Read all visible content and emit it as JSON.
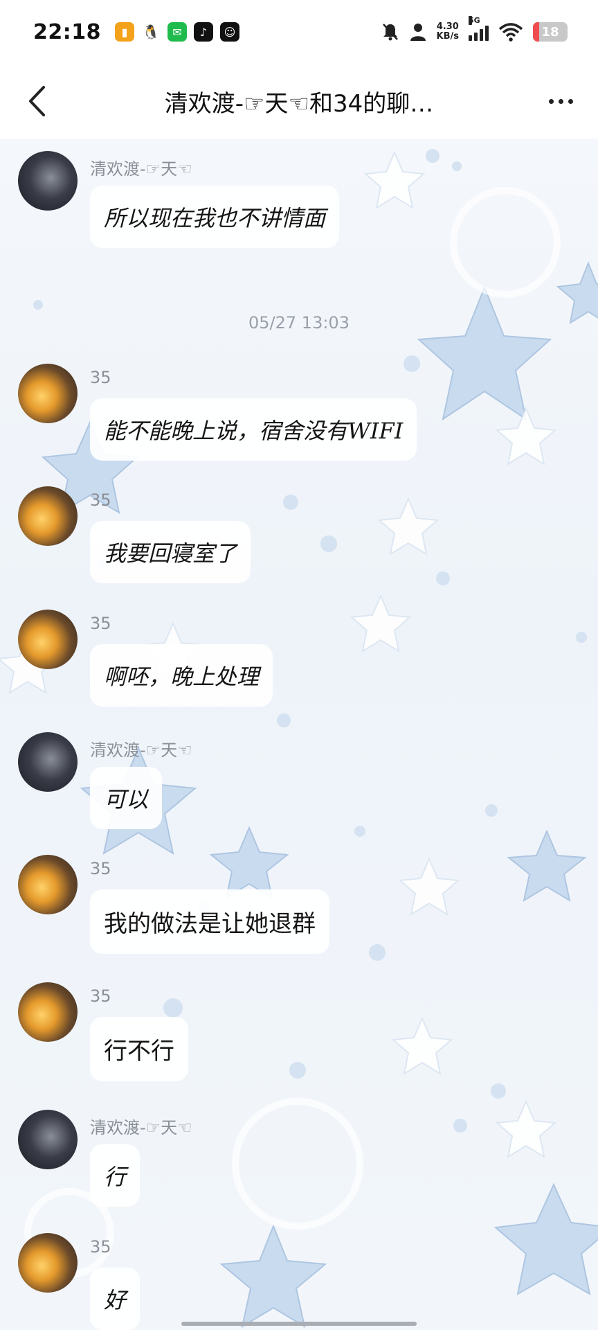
{
  "status_bar": {
    "time": "22:18",
    "speed_value": "4.30",
    "speed_unit": "KB/s",
    "network": "5G",
    "battery": "18"
  },
  "header": {
    "title": "清欢渡-☞天☜和34的聊…"
  },
  "chat": {
    "timestamp": "05/27 13:03",
    "messages": [
      {
        "sender": "清欢渡-☞天☜",
        "text": "所以现在我也不讲情面",
        "avatar": "avatar-a"
      },
      {
        "sender": "35",
        "text": "能不能晚上说，宿舍没有WIFI",
        "avatar": "avatar-b"
      },
      {
        "sender": "35",
        "text": "我要回寝室了",
        "avatar": "avatar-b"
      },
      {
        "sender": "35",
        "text": "啊呸，晚上处理",
        "avatar": "avatar-b"
      },
      {
        "sender": "清欢渡-☞天☜",
        "text": "可以",
        "avatar": "avatar-a"
      },
      {
        "sender": "35",
        "text": "我的做法是让她退群",
        "avatar": "avatar-b"
      },
      {
        "sender": "35",
        "text": "行不行",
        "avatar": "avatar-b"
      },
      {
        "sender": "清欢渡-☞天☜",
        "text": "行",
        "avatar": "avatar-a"
      },
      {
        "sender": "35",
        "text": "好",
        "avatar": "avatar-b"
      }
    ]
  },
  "colors": {
    "accent": "#c9dbee",
    "text": "#151515",
    "muted": "#8b8f98"
  }
}
